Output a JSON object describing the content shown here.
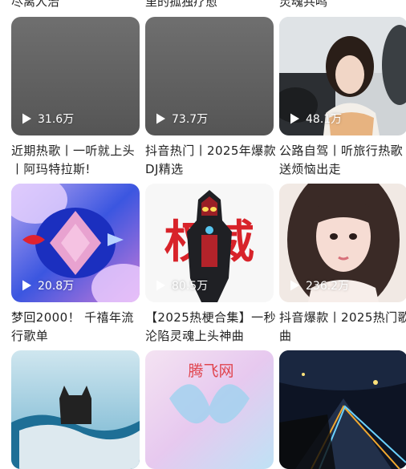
{
  "top_titles": [
    "尽离人治",
    "里的孤独疗愈",
    "灵魂共鸣"
  ],
  "playlists": [
    {
      "plays": "31.6万",
      "title": "近期热歌丨一听就上头丨阿玛特拉斯!"
    },
    {
      "plays": "73.7万",
      "title": "抖音热门丨2025年爆款DJ精选"
    },
    {
      "plays": "48.1万",
      "title": "公路自驾丨听旅行热歌送烦恼出走"
    },
    {
      "plays": "20.8万",
      "title": "梦回2000！ 千禧年流行歌单"
    },
    {
      "plays": "80.5万",
      "title": "【2025热梗合集】一秒沦陷灵魂上头神曲"
    },
    {
      "plays": "236.2万",
      "title": "抖音爆款丨2025热门歌曲"
    }
  ],
  "cover_texts": {
    "ultraman_banner": "权威",
    "watermark": "腾飞网"
  },
  "icons": {
    "play": "play-triangle-icon"
  }
}
